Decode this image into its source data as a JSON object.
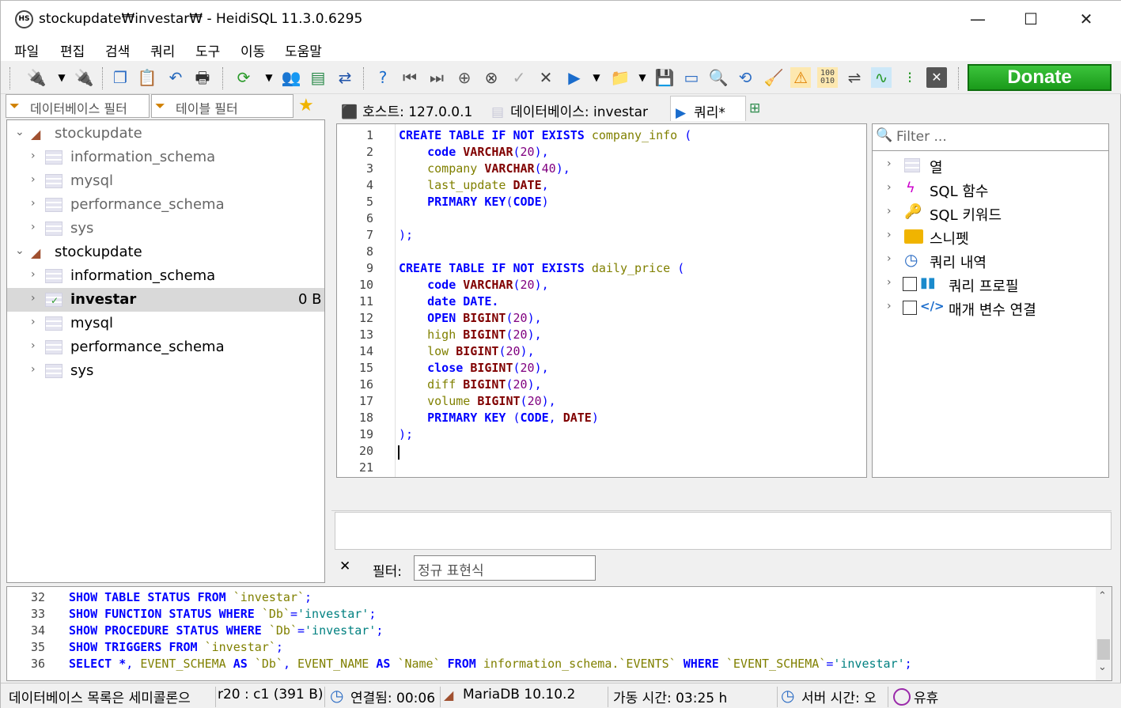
{
  "window": {
    "title": "stockupdate₩investar₩ - HeidiSQL 11.3.0.6295",
    "app_icon": "HS",
    "minimize": "—",
    "maximize": "☐",
    "close": "✕"
  },
  "menu": [
    "파일",
    "편집",
    "검색",
    "쿼리",
    "도구",
    "이동",
    "도움말"
  ],
  "toolbar": {
    "donate_label": "Donate"
  },
  "filters": {
    "db_filter_placeholder": "데이터베이스 필터",
    "table_filter_placeholder": "테이블 필터"
  },
  "tree": {
    "groups": [
      {
        "name": "stockupdate",
        "expanded": true,
        "active": false,
        "children": [
          "information_schema",
          "mysql",
          "performance_schema",
          "sys"
        ]
      },
      {
        "name": "stockupdate",
        "expanded": true,
        "active": true,
        "children": [
          "information_schema",
          "investar",
          "mysql",
          "performance_schema",
          "sys"
        ]
      }
    ],
    "selected_db": "investar",
    "selected_size": "0 B"
  },
  "tabs": [
    {
      "label": "호스트: 127.0.0.1",
      "active": false
    },
    {
      "label": "데이터베이스: investar",
      "active": false
    },
    {
      "label": "쿼리*",
      "active": true
    }
  ],
  "editor": {
    "line_count": 21,
    "lines": [
      "CREATE TABLE IF NOT EXISTS company_info (",
      "    code VARCHAR(20),",
      "    company VARCHAR(40),",
      "    last_update DATE,",
      "    PRIMARY KEY(CODE)",
      "",
      ");",
      "",
      "CREATE TABLE IF NOT EXISTS daily_price (",
      "    code VARCHAR(20),",
      "    date DATE.",
      "    OPEN BIGINT(20),",
      "    high BIGINT(20),",
      "    low BIGINT(20),",
      "    close BIGINT(20),",
      "    diff BIGINT(20),",
      "    volume BIGINT(20),",
      "    PRIMARY KEY (CODE, DATE)",
      ");",
      "",
      ""
    ]
  },
  "helper": {
    "filter_placeholder": "Filter ...",
    "items": [
      "열",
      "SQL 함수",
      "SQL 키워드",
      "스니펫",
      "쿼리 내역",
      "쿼리 프로필",
      "매개 변수 연결"
    ]
  },
  "result_filter": {
    "close": "✕",
    "label": "필터:",
    "placeholder": "정규 표현식"
  },
  "log": {
    "lines": [
      {
        "n": "32",
        "text": "SHOW TABLE STATUS FROM `investar`;"
      },
      {
        "n": "33",
        "text": "SHOW FUNCTION STATUS WHERE `Db`='investar';"
      },
      {
        "n": "34",
        "text": "SHOW PROCEDURE STATUS WHERE `Db`='investar';"
      },
      {
        "n": "35",
        "text": "SHOW TRIGGERS FROM `investar`;"
      },
      {
        "n": "36",
        "text": "SELECT *, EVENT_SCHEMA AS `Db`, EVENT_NAME AS `Name` FROM information_schema.`EVENTS` WHERE `EVENT_SCHEMA`='investar';"
      }
    ]
  },
  "status": {
    "hint": "데이터베이스 목록은 세미콜론으",
    "cursor": "r20 : c1 (391 B)",
    "connected": "연결됨: 00:06",
    "server": "MariaDB 10.10.2",
    "uptime": "가동 시간: 03:25 h",
    "server_time": "서버 시간: 오",
    "idle": "유휴"
  },
  "colors": {
    "keyword": "#0000ff",
    "type": "#800000",
    "identifier": "#808000",
    "number": "#800080",
    "string": "#008080",
    "donate": "#1a9a1a"
  }
}
